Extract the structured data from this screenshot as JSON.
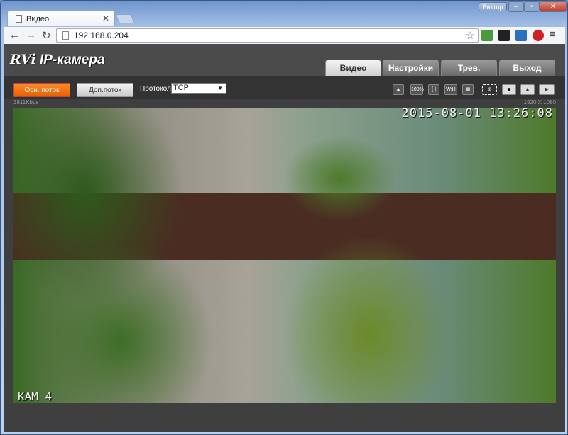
{
  "browser": {
    "tab_title": "Видео",
    "user": "Виктор",
    "url": "192.168.0.204"
  },
  "app": {
    "logo": "RVi",
    "title": "IP-камера",
    "nav_tabs": [
      {
        "label": "Видео",
        "active": true
      },
      {
        "label": "Настройки"
      },
      {
        "label": "Трев."
      },
      {
        "label": "Выход"
      }
    ],
    "toolbar": {
      "main_stream": "Осн. поток",
      "sub_stream": "Доп.поток",
      "protocol_label": "Протокол",
      "protocol_value": "TCP",
      "icons": [
        "snapshot-icon",
        "zoom-100-icon",
        "fit-screen-icon",
        "aspect-wh-icon",
        "fullscreen-icon",
        "digital-zoom-icon",
        "record-icon",
        "image-icon",
        "video-camera-icon"
      ],
      "icon_labels": {
        "zoom": "100%",
        "wh": "W:H"
      }
    },
    "bitrate": "3811Kbps",
    "resolution": "1920 X 1080",
    "video": {
      "timestamp": "2015-08-01 13:26:08",
      "camera_name": "КАМ 4"
    }
  }
}
